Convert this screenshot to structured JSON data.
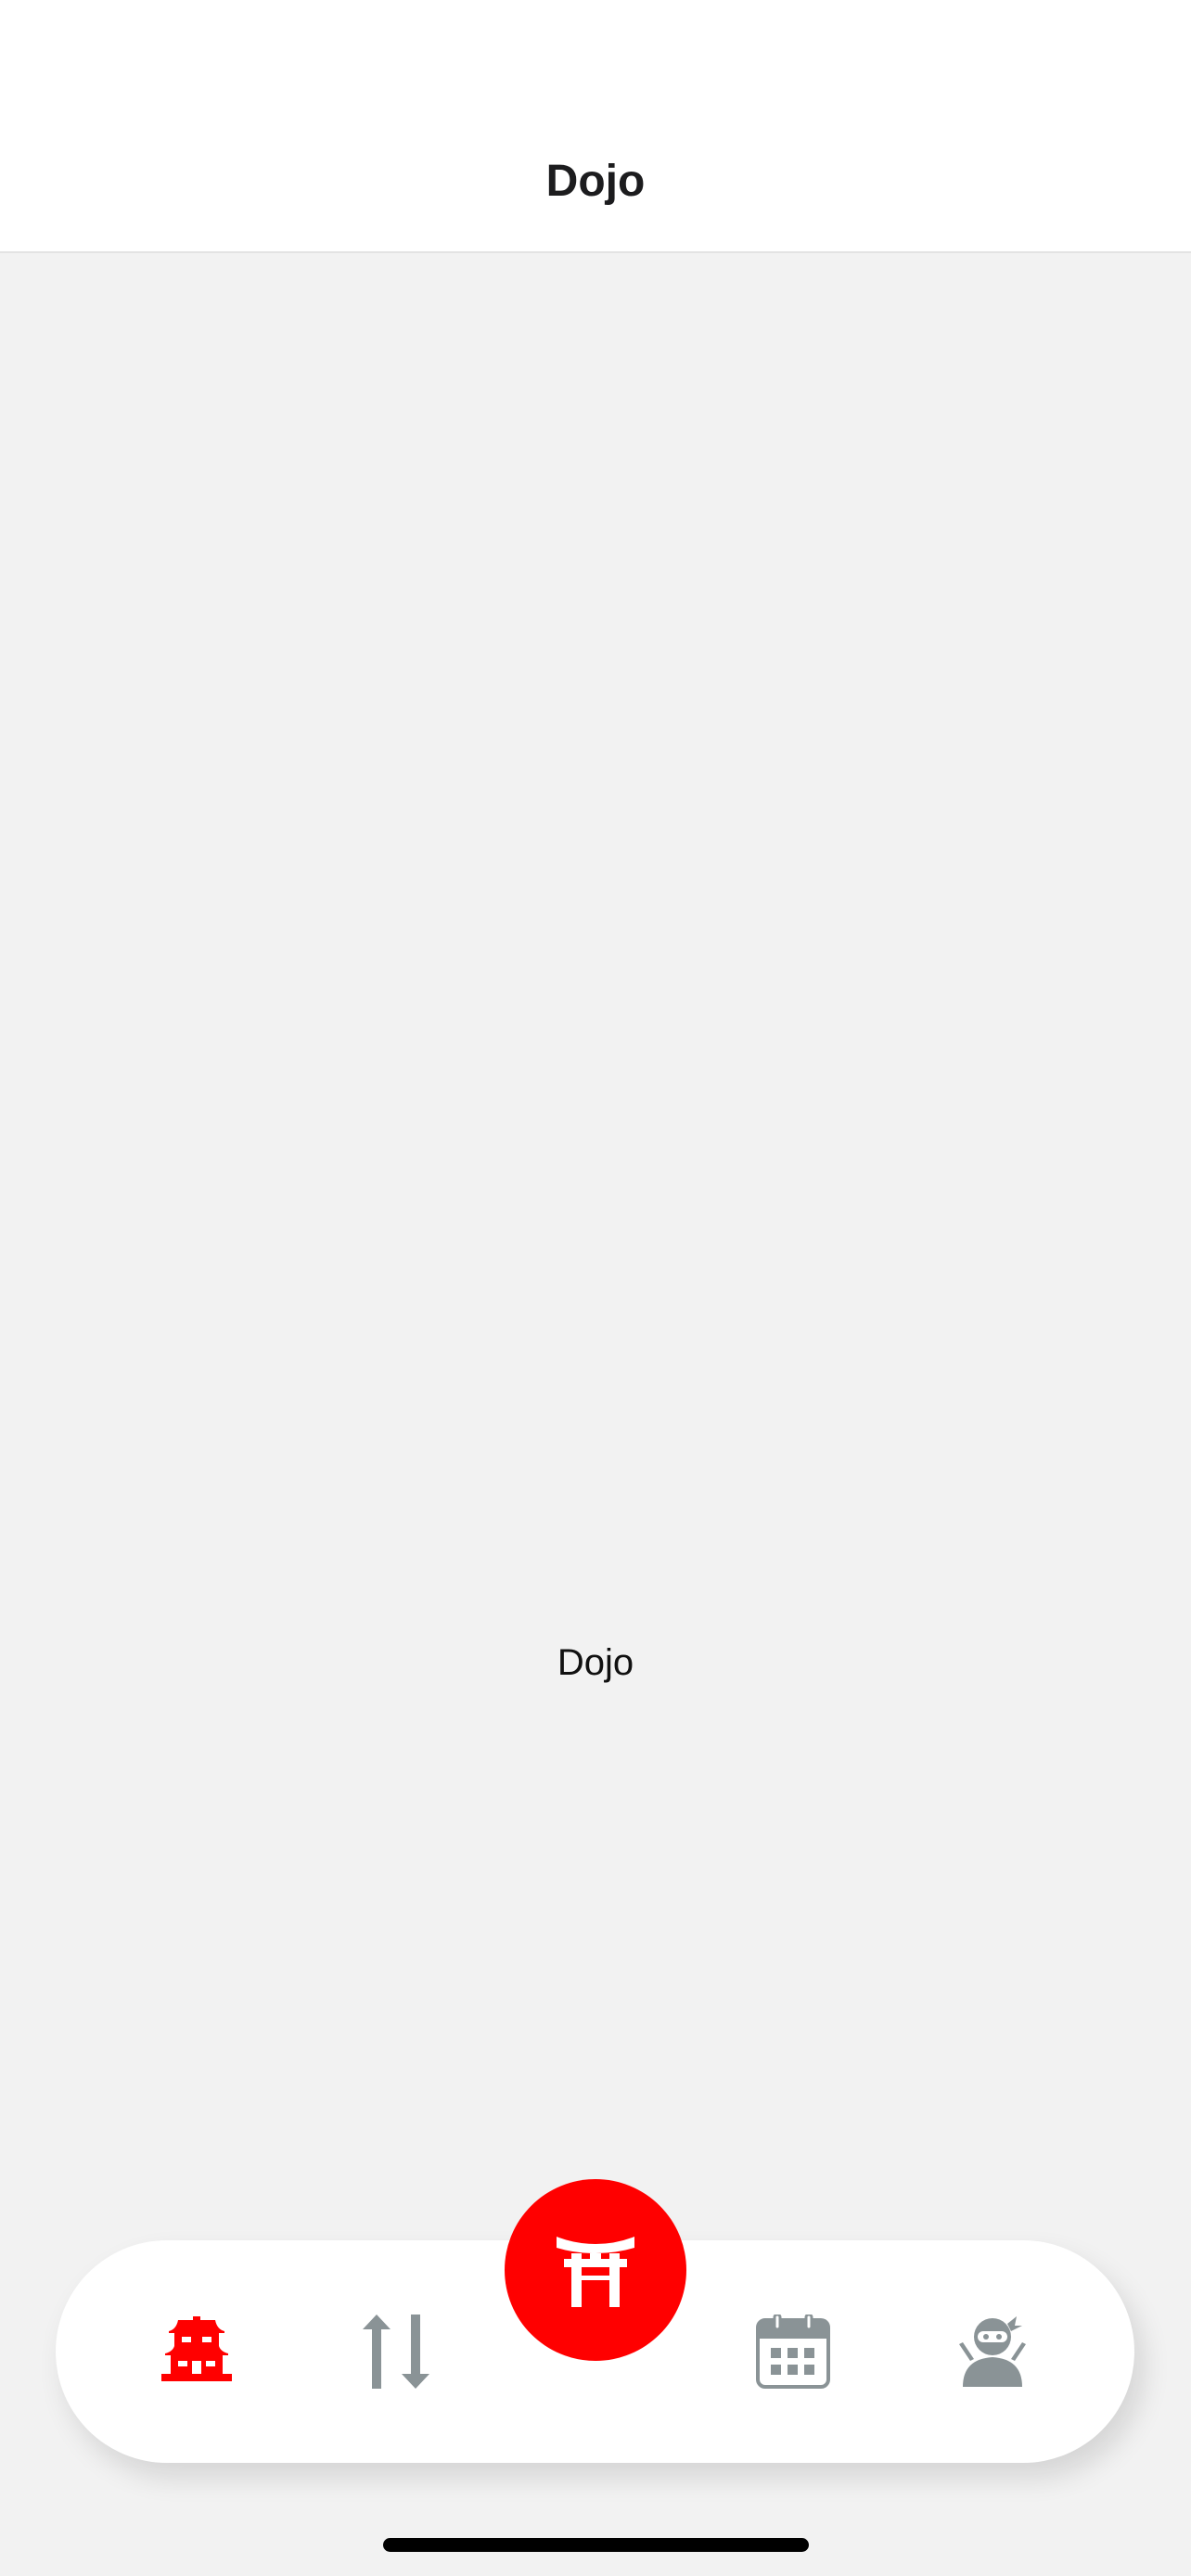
{
  "header": {
    "title": "Dojo"
  },
  "main": {
    "label": "Dojo"
  },
  "tabbar": {
    "items": [
      {
        "icon": "dojo-house-icon",
        "active": true
      },
      {
        "icon": "sort-arrows-icon",
        "active": false
      },
      {
        "icon": "torii-gate-icon",
        "center": true
      },
      {
        "icon": "calendar-icon",
        "active": false
      },
      {
        "icon": "ninja-icon",
        "active": false
      }
    ]
  },
  "colors": {
    "accent": "#ff0000",
    "inactive_icon": "#8a9396",
    "header_bg": "#ffffff",
    "content_bg": "#f2f2f2"
  }
}
